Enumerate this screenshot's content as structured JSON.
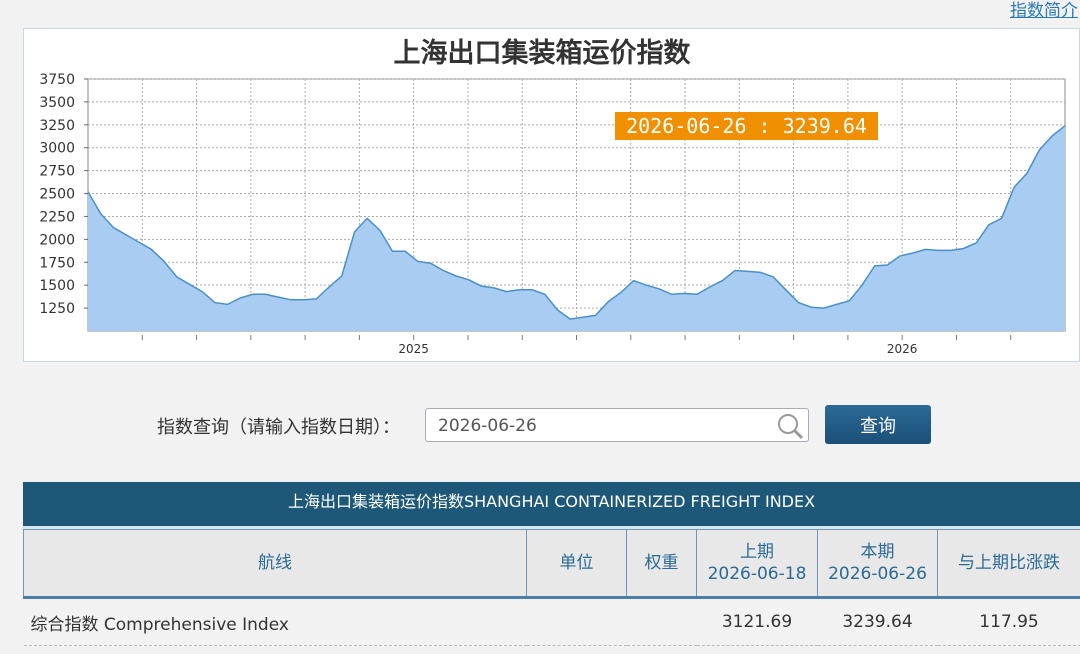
{
  "header": {
    "link_label": "指数简介"
  },
  "chart_data": {
    "type": "area",
    "title": "上海出口集装箱运价指数",
    "tooltip": "2026-06-26 : 3239.64",
    "y_ticks": [
      3750,
      3500,
      3250,
      3000,
      2750,
      2500,
      2250,
      2000,
      1750,
      1500,
      1250
    ],
    "ylim": [
      1000,
      3750
    ],
    "x_tick_labels": [
      "2025",
      "2026"
    ],
    "grid": true,
    "fill_color": "#a8ccf2",
    "line_color": "#4a90c8",
    "values": [
      2520,
      2280,
      2130,
      2050,
      1970,
      1890,
      1760,
      1590,
      1510,
      1430,
      1310,
      1290,
      1360,
      1400,
      1400,
      1370,
      1340,
      1340,
      1350,
      1480,
      1600,
      2080,
      2230,
      2100,
      1870,
      1870,
      1760,
      1740,
      1660,
      1600,
      1560,
      1490,
      1470,
      1430,
      1450,
      1450,
      1400,
      1230,
      1130,
      1150,
      1170,
      1320,
      1420,
      1550,
      1500,
      1460,
      1400,
      1410,
      1400,
      1480,
      1550,
      1660,
      1650,
      1640,
      1590,
      1450,
      1310,
      1260,
      1250,
      1290,
      1330,
      1500,
      1710,
      1720,
      1820,
      1850,
      1890,
      1880,
      1880,
      1900,
      1960,
      2160,
      2230,
      2570,
      2720,
      2980,
      3130,
      3239.64
    ]
  },
  "query": {
    "label": "指数查询（请输入指数日期）：",
    "input_value": "2026-06-26",
    "button_label": "查询"
  },
  "table": {
    "caption": "上海出口集装箱运价指数SHANGHAI CONTAINERIZED FREIGHT INDEX",
    "headers": {
      "route": "航线",
      "unit": "单位",
      "weight": "权重",
      "prev_label": "上期",
      "prev_date": "2026-06-18",
      "curr_label": "本期",
      "curr_date": "2026-06-26",
      "change": "与上期比涨跌"
    },
    "rows": [
      {
        "route": "综合指数 Comprehensive Index",
        "unit": "",
        "weight": "",
        "prev": "3121.69",
        "curr": "3239.64",
        "change": "117.95"
      }
    ]
  }
}
